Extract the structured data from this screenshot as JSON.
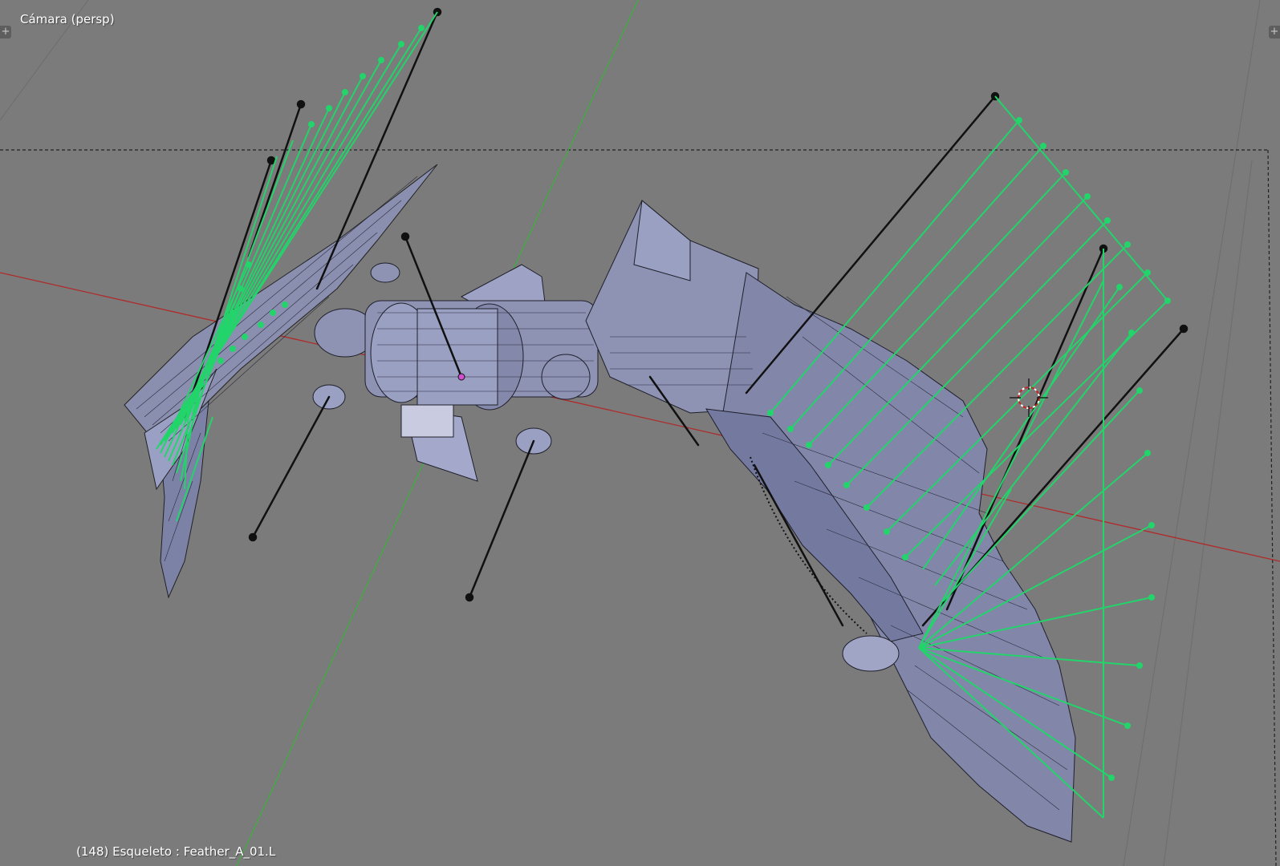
{
  "viewport": {
    "view_name": "Cámara (persp)",
    "object_info": "(148) Esqueleto : Feather_A_01.L",
    "corner_left_icon": "plus-icon",
    "corner_right_icon": "plus-icon",
    "corner_symbol": "+",
    "background_color": "#7b7b7b",
    "x_axis_color": "#b02a2a",
    "y_axis_color": "#3fae3f",
    "bone_color": "#22d46a",
    "mesh_color": "#8a8fb0"
  }
}
